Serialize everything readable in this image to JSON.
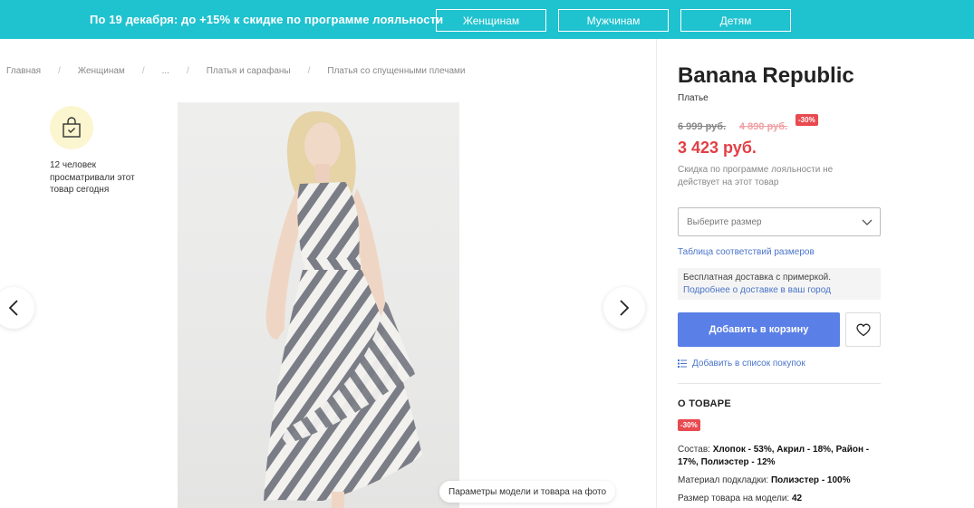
{
  "promo": {
    "text": "По 19 декабря: до +15% к скидке по программе лояльности",
    "buttons": [
      "Женщинам",
      "Мужчинам",
      "Детям"
    ]
  },
  "breadcrumb": [
    "Главная",
    "Женщинам",
    "...",
    "Платья и сарафаны",
    "Платья со спущенными плечами"
  ],
  "viewers": {
    "icon": "shopping-bag-icon",
    "text": "12 человек просматривали этот товар сегодня"
  },
  "gallery": {
    "model_params_label": "Параметры модели и товара на фото"
  },
  "product": {
    "brand": "Banana Republic",
    "category": "Платье",
    "price_original": "6 999 руб.",
    "price_discounted": "4 890 руб.",
    "discount_badge": "-30%",
    "price_final": "3 423 руб.",
    "loyalty_note": "Скидка по программе лояльности не действует на этот товар",
    "size_placeholder": "Выберите размер",
    "size_table_link": "Таблица соответствий размеров",
    "delivery_text": "Бесплатная доставка с примеркой.",
    "delivery_link": "Подробнее о доставке в ваш город",
    "add_to_cart": "Добавить в корзину",
    "add_to_list": "Добавить в список покупок"
  },
  "about": {
    "heading": "О ТОВАРЕ",
    "badge": "-30%",
    "composition_label": "Состав:",
    "composition_value": "Хлопок - 53%, Акрил - 18%, Район - 17%, Полиэстер - 12%",
    "lining_label": "Материал подкладки:",
    "lining_value": "Полиэстер - 100%",
    "model_size_label": "Размер товара на модели:",
    "model_size_value": "42"
  },
  "colors": {
    "banner": "#1fc2cf",
    "primary_button": "#5a7fe6",
    "price_red": "#e23f44",
    "badge_red": "#e84a50",
    "link_blue": "#4a74c9"
  }
}
